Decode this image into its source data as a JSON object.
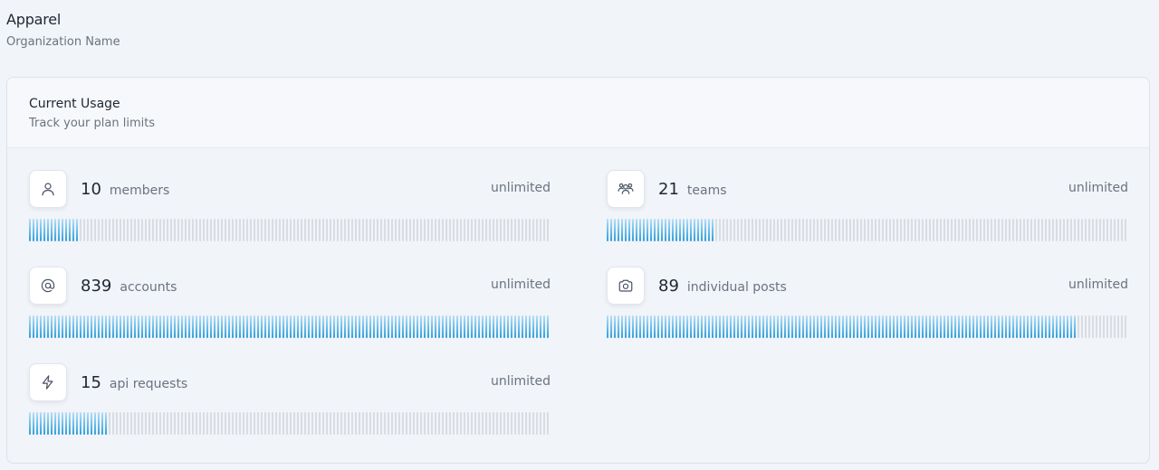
{
  "organization": {
    "name": "Apparel",
    "label": "Organization Name"
  },
  "usage_card": {
    "title": "Current Usage",
    "subtitle": "Track your plan limits"
  },
  "metrics": [
    {
      "key": "members",
      "count": "10",
      "label": "members",
      "limit": "unlimited",
      "icon": "user-icon",
      "fill_fraction": 0.1
    },
    {
      "key": "teams",
      "count": "21",
      "label": "teams",
      "limit": "unlimited",
      "icon": "users-group-icon",
      "fill_fraction": 0.21
    },
    {
      "key": "accounts",
      "count": "839",
      "label": "accounts",
      "limit": "unlimited",
      "icon": "at-sign-icon",
      "fill_fraction": 1.0
    },
    {
      "key": "individual_posts",
      "count": "89",
      "label": "individual posts",
      "limit": "unlimited",
      "icon": "camera-icon",
      "fill_fraction": 0.9
    },
    {
      "key": "api_requests",
      "count": "15",
      "label": "api requests",
      "limit": "unlimited",
      "icon": "lightning-icon",
      "fill_fraction": 0.15
    }
  ],
  "colors": {
    "bar_fill_top": "#b8def6",
    "bar_fill_bottom": "#2f9ddc",
    "bar_empty": "#d9dde3",
    "page_background": "#f1f4f8"
  }
}
